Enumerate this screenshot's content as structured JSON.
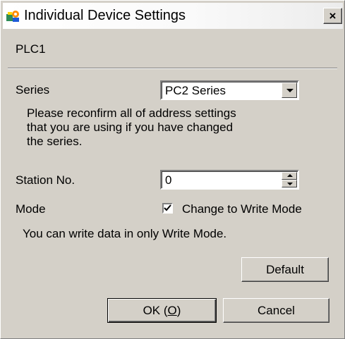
{
  "window": {
    "title": "Individual Device Settings",
    "close_glyph": "×",
    "icon": "device-settings-icon"
  },
  "device_name": "PLC1",
  "series": {
    "label": "Series",
    "value": "PC2 Series",
    "note_lines": [
      "Please reconfirm all of address settings",
      "that you are using if you have changed",
      "the series."
    ]
  },
  "station": {
    "label": "Station No.",
    "value": "0"
  },
  "mode": {
    "label": "Mode",
    "checkbox_label": "Change to Write Mode",
    "checked": true,
    "note": "You can write data in only Write Mode."
  },
  "buttons": {
    "default": "Default",
    "ok_prefix": "OK (",
    "ok_mnemonic": "O",
    "ok_suffix": ")",
    "cancel": "Cancel"
  },
  "colors": {
    "face": "#d4d0c8",
    "shadow": "#808080",
    "highlight": "#ffffff"
  }
}
